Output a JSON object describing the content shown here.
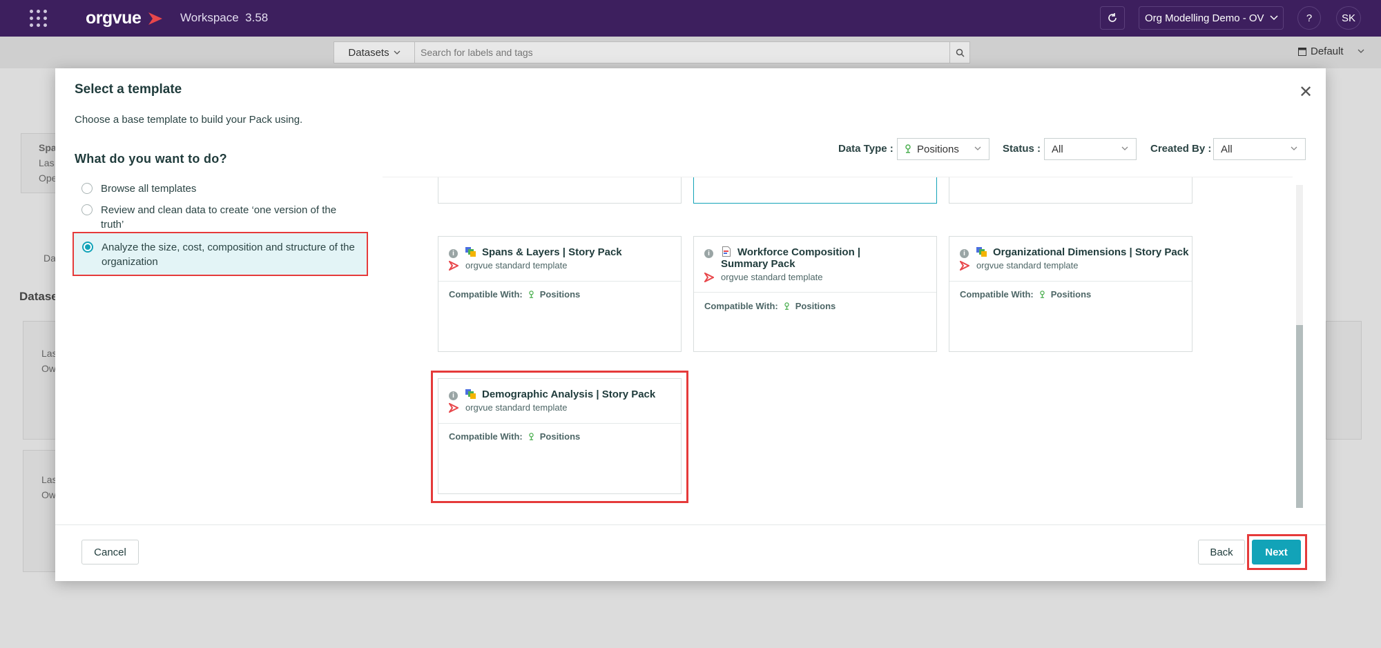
{
  "topbar": {
    "logo_text": "orgvue",
    "workspace_label": "Workspace",
    "version": "3.58",
    "org_selector": "Org Modelling Demo - OV",
    "help_label": "?",
    "user_initials": "SK",
    "brand_color": "#3d1f5e"
  },
  "subbar": {
    "datasets_label": "Datasets",
    "search_placeholder": "Search for labels and tags",
    "view_label": "Default"
  },
  "modal": {
    "title": "Select a template",
    "subtitle": "Choose a base template to build your Pack using.",
    "question": "What do you want to do?",
    "options": [
      {
        "label": "Browse all templates",
        "selected": false
      },
      {
        "label": "Review and clean data to create ‘one version of the truth’",
        "selected": false
      },
      {
        "label": "Analyze the size, cost, composition and structure of the organization",
        "selected": true
      }
    ],
    "filters": {
      "data_type_label": "Data Type :",
      "data_type_value": "Positions",
      "status_label": "Status :",
      "status_value": "All",
      "created_by_label": "Created By :",
      "created_by_value": "All"
    },
    "cards": [
      {
        "title": "Spans & Layers | Story Pack",
        "source": "orgvue standard template",
        "compat_label": "Compatible With:",
        "compat_value": "Positions",
        "icon": "story-pack-icon"
      },
      {
        "title": "Workforce Composition | Summary Pack",
        "source": "orgvue standard template",
        "compat_label": "Compatible With:",
        "compat_value": "Positions",
        "icon": "summary-pack-icon"
      },
      {
        "title": "Organizational Dimensions | Story Pack",
        "source": "orgvue standard template",
        "compat_label": "Compatible With:",
        "compat_value": "Positions",
        "icon": "story-pack-icon"
      },
      {
        "title": "Demographic Analysis | Story Pack",
        "source": "orgvue standard template",
        "compat_label": "Compatible With:",
        "compat_value": "Positions",
        "icon": "story-pack-icon"
      }
    ],
    "buttons": {
      "cancel": "Cancel",
      "back": "Back",
      "next": "Next"
    },
    "accent_color": "#12a3b8",
    "highlight_color": "#e53a3a"
  },
  "background": {
    "section_label": "Datase",
    "tab_label": "Da",
    "card1": [
      "Spa",
      "Las",
      "Ope"
    ],
    "card2": [
      "Las",
      "Ow"
    ],
    "card3": [
      "Las",
      "Ow"
    ]
  }
}
